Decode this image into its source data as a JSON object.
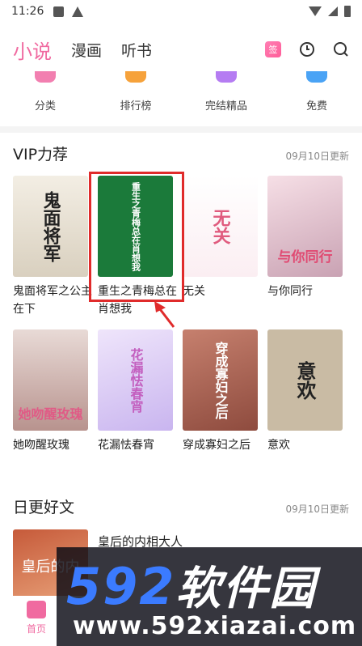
{
  "status_bar": {
    "time": "11:26"
  },
  "top_nav": {
    "tabs": [
      {
        "label": "小说",
        "active": true
      },
      {
        "label": "漫画",
        "active": false
      },
      {
        "label": "听书",
        "active": false
      }
    ],
    "sign_label": "签",
    "icons": [
      "sign-in-icon",
      "history-clock-icon",
      "search-icon"
    ]
  },
  "categories": [
    {
      "label": "分类",
      "color": "#f27fb0"
    },
    {
      "label": "排行榜",
      "color": "#f6a23b"
    },
    {
      "label": "完结精品",
      "color": "#b57cf2"
    },
    {
      "label": "免费",
      "color": "#4aa3f5"
    }
  ],
  "vip_section": {
    "title": "VIP力荐",
    "date": "09月10日更新",
    "books": [
      {
        "title": "鬼面将军之公主在下",
        "cover_text": "鬼面将军"
      },
      {
        "title": "重生之青梅总在肖想我",
        "cover_text": "重生之青梅总在肖想我"
      },
      {
        "title": "无关",
        "cover_text": "无关"
      },
      {
        "title": "与你同行",
        "cover_text": "与你同行"
      },
      {
        "title": "她吻醒玫瑰",
        "cover_text": "她吻醒玫瑰"
      },
      {
        "title": "花漏怯春宵",
        "cover_text": "花漏怯春宵"
      },
      {
        "title": "穿成寡妇之后",
        "cover_text": "穿成寡妇之后"
      },
      {
        "title": "意欢",
        "cover_text": "意欢"
      }
    ]
  },
  "daily_section": {
    "title": "日更好文",
    "date": "09月10日更新",
    "items": [
      {
        "title": "皇后的内相大人",
        "cover_text": "皇后的内"
      }
    ]
  },
  "bottom_nav": {
    "home_label": "首页"
  },
  "watermark": {
    "logo_num": "592",
    "logo_cn": "软件园",
    "url": "www.592xiazai.com"
  }
}
